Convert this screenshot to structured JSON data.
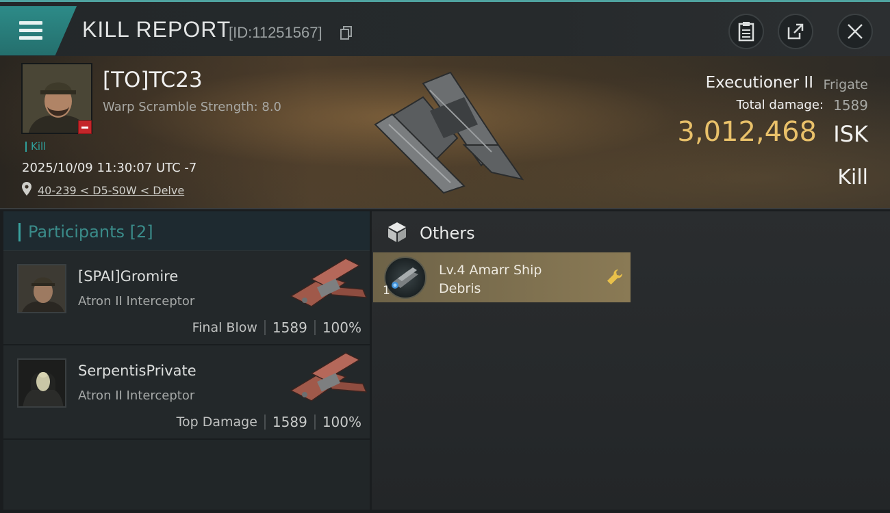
{
  "topbar": {
    "title": "KILL REPORT",
    "report_id": "[ID:11251567]"
  },
  "victim": {
    "name": "[TO]TC23",
    "warp_scramble": "Warp Scramble Strength: 8.0",
    "kill_tag": "Kill",
    "datetime": "2025/10/09 11:30:07 UTC -7",
    "location": "40-239 < D5-S0W < Delve",
    "ship_name": "Executioner II",
    "ship_class": "Frigate",
    "total_damage_label": "Total damage:",
    "total_damage": "1589",
    "isk_value": "3,012,468",
    "isk_unit": "ISK",
    "result": "Kill"
  },
  "participants": {
    "title": "Participants [2]",
    "items": [
      {
        "name": "[SPAI]Gromire",
        "ship": "Atron II Interceptor",
        "tag": "Final Blow",
        "damage": "1589",
        "percent": "100%"
      },
      {
        "name": "SerpentisPrivate",
        "ship": "Atron II Interceptor",
        "tag": "Top Damage",
        "damage": "1589",
        "percent": "100%"
      }
    ]
  },
  "others": {
    "title": "Others",
    "items": [
      {
        "quantity": "1",
        "name": "Lv.4 Amarr Ship Debris"
      }
    ]
  },
  "icons": {
    "menu": "menu-icon",
    "copy": "copy-icon",
    "report": "clipboard-icon",
    "share": "share-icon",
    "close": "close-icon",
    "location": "location-pin-icon",
    "others": "cube-icon",
    "item_action": "wrench-icon"
  },
  "colors": {
    "accent": "#3aa3a0",
    "isk": "#e9c16a",
    "danger": "#c4262a"
  }
}
